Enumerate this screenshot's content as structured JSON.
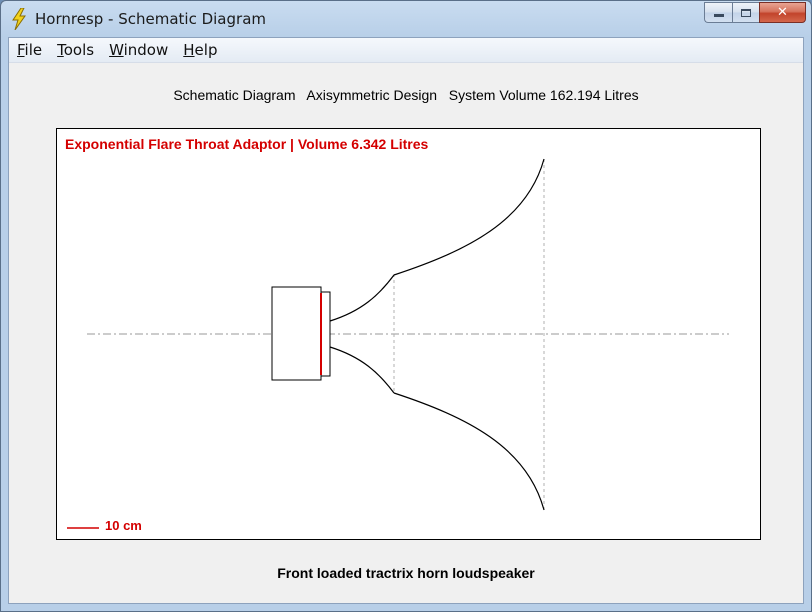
{
  "window": {
    "title": "Hornresp - Schematic Diagram",
    "icon": "lightning-bolt-icon",
    "controls": {
      "minimize": "minimize-icon",
      "maximize": "maximize-icon",
      "close": "✕"
    }
  },
  "menu": [
    {
      "key": "F",
      "rest": "ile"
    },
    {
      "key": "T",
      "rest": "ools"
    },
    {
      "key": "W",
      "rest": "indow"
    },
    {
      "key": "H",
      "rest": "elp"
    }
  ],
  "header": "Schematic Diagram   Axisymmetric Design   System Volume 162.194 Litres",
  "diagram": {
    "adaptor_label": "Exponential Flare Throat Adaptor | Volume 6.342 Litres",
    "scale_label": "10 cm",
    "colors": {
      "highlight": "#d40000",
      "outline": "#000000",
      "guide": "#9a9a9a"
    }
  },
  "footer": "Front loaded tractrix horn loudspeaker"
}
